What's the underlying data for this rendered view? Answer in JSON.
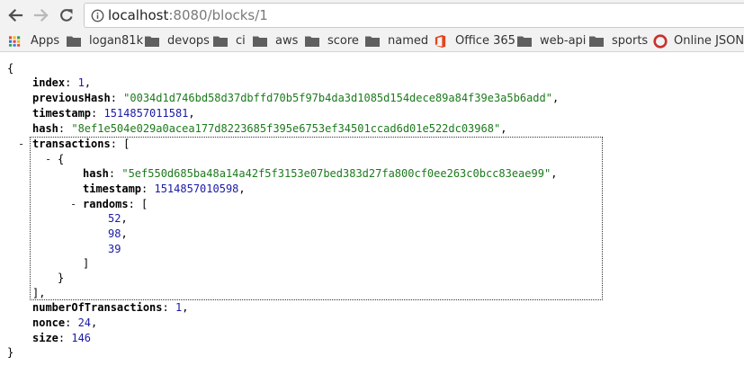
{
  "browser": {
    "url_host": "localhost",
    "url_rest": ":8080/blocks/1"
  },
  "bookmarks": [
    {
      "label": "Apps",
      "icon": "apps-grid-icon"
    },
    {
      "label": "logan81k",
      "icon": "folder-icon"
    },
    {
      "label": "devops",
      "icon": "folder-icon"
    },
    {
      "label": "ci",
      "icon": "folder-icon"
    },
    {
      "label": "aws",
      "icon": "folder-icon"
    },
    {
      "label": "score",
      "icon": "folder-icon"
    },
    {
      "label": "named",
      "icon": "folder-icon"
    },
    {
      "label": "Office 365",
      "icon": "office-icon"
    },
    {
      "label": "web-api",
      "icon": "folder-icon"
    },
    {
      "label": "sports",
      "icon": "folder-icon"
    },
    {
      "label": "Online JSON Viewer",
      "icon": "json-viewer-icon"
    }
  ],
  "json": {
    "open_brace": "{",
    "close_brace": "}",
    "toggle_symbol": "-",
    "index_key": "index",
    "index_value": "1",
    "previousHash_key": "previousHash",
    "previousHash_value": "\"0034d1d746bd58d37dbffd70b5f97b4da3d1085d154dece89a84f39e3a5b6add\"",
    "timestamp_key": "timestamp",
    "timestamp_value": "1514857011581",
    "hash_key": "hash",
    "hash_value": "\"8ef1e504e029a0acea177d8223685f395e6753ef34501ccad6d01e522dc03968\"",
    "transactions_key": "transactions",
    "open_bracket": "[",
    "close_bracket": "]",
    "tx_hash_key": "hash",
    "tx_hash_value": "\"5ef550d685ba48a14a42f5f3153e07bed383d27fa800cf0ee263c0bcc83eae99\"",
    "tx_timestamp_key": "timestamp",
    "tx_timestamp_value": "1514857010598",
    "randoms_key": "randoms",
    "randoms": [
      "52",
      "98",
      "39"
    ],
    "numberOfTransactions_key": "numberOfTransactions",
    "numberOfTransactions_value": "1",
    "nonce_key": "nonce",
    "nonce_value": "24",
    "size_key": "size",
    "size_value": "146"
  }
}
